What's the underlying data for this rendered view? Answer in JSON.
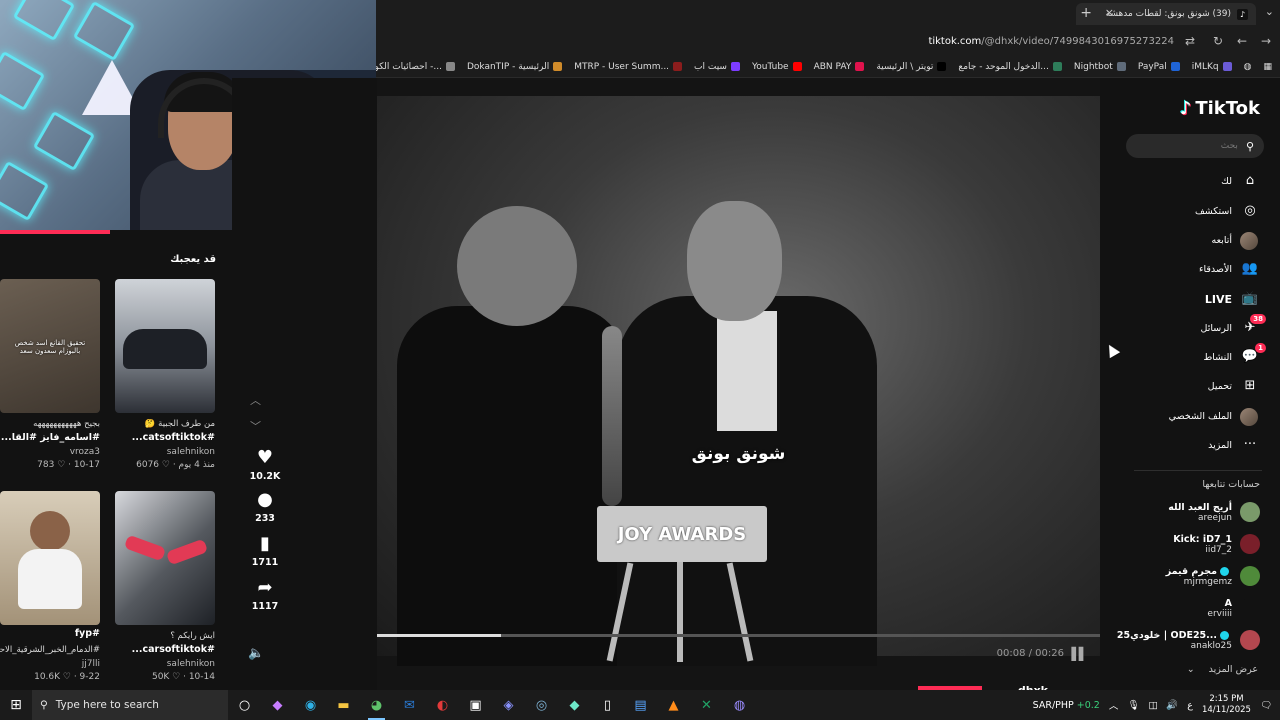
{
  "browser": {
    "tab_title": "(39) شونق بونق: لقطات مدهشة",
    "tab_close": "×",
    "new_tab": "+",
    "tab_menu": "⌄",
    "url_domain": "tiktok.com",
    "url_path": "/@dhxk/video/7499843016975273224",
    "bookmarks": [
      {
        "label": "iMLKq",
        "color": "#6b5bd6"
      },
      {
        "label": "PayPal",
        "color": "#1f64d6"
      },
      {
        "label": "Nightbot",
        "color": "#5f6b7a"
      },
      {
        "label": "الدخول الموحد - جامع...",
        "color": "#2e7d5a"
      },
      {
        "label": "تويتر \\ الرئيسية",
        "color": "#000000"
      },
      {
        "label": "ABN PAY",
        "color": "#e0134d"
      },
      {
        "label": "YouTube",
        "color": "#ff0000"
      },
      {
        "label": "سيت اب",
        "color": "#7d3cff"
      },
      {
        "label": "MTRP - User Summ...",
        "color": "#8b1d1d"
      },
      {
        "label": "DokanTIP - الرئيسية",
        "color": "#d08b2a"
      },
      {
        "label": "احصائيات الكوبون -...",
        "color": "#888888"
      },
      {
        "label": "احصائيات",
        "color": "#e0134d"
      }
    ]
  },
  "left": {
    "section_title": "قد يعجبك",
    "recs": [
      {
        "cap1": "بجيح هههههههههههه",
        "cap2": "#اسامه_فايز #القا...",
        "author": "vroza3",
        "meta": "783 ♡ · 10-17",
        "thumb_color": "#5a5148",
        "overlay": "تحقيق القانع اسد شخص بالبوزام سعدون سعد"
      },
      {
        "cap1": "من طرف الجبية 🤔",
        "cap2": "#catsoftiktok...",
        "author": "salehnikon",
        "meta": "6076 ♡ · منذ 4 يوم",
        "thumb_color": "#9aa0a8",
        "overlay": ""
      },
      {
        "cap1": "",
        "cap2": "#fyp",
        "author": "",
        "meta": "",
        "thumb_color": "#c4b49c",
        "overlay": ""
      },
      {
        "cap1": "ايش رايكم ؟",
        "cap2": "#carsoftiktok...",
        "author": "salehnikon",
        "meta": "50K ♡ · 10-14",
        "thumb_color": "#3b3f47",
        "overlay": ""
      }
    ],
    "rec3_cap1": "#الدمام_الخبر_الشرقية_الاحـ...",
    "rec3_author": "jj7lli",
    "rec3_meta": "10.6K ♡ · 9-22"
  },
  "actions": {
    "likes": "10.2K",
    "comments": "233",
    "saves": "1711",
    "shares": "1117"
  },
  "video": {
    "subtitle": "شونق بونق",
    "podium_text": "JOY AWARDS",
    "time": "00:08 / 00:26",
    "progress": 0.31,
    "author": "dhxk"
  },
  "sidebar": {
    "logo": "TikTok",
    "search_placeholder": "بحث",
    "nav": [
      {
        "label": "لك",
        "icon": "⌂"
      },
      {
        "label": "استكشف",
        "icon": "◎"
      },
      {
        "label": "أتابعه",
        "icon": "avatar"
      },
      {
        "label": "الأصدقاء",
        "icon": "👥"
      },
      {
        "label": "LIVE",
        "icon": "📺"
      },
      {
        "label": "الرسائل",
        "icon": "✈",
        "badge": "38"
      },
      {
        "label": "النشاط",
        "icon": "💬",
        "badge": "1"
      },
      {
        "label": "تحميل",
        "icon": "⊞"
      },
      {
        "label": "الملف الشخصي",
        "icon": "avatar"
      },
      {
        "label": "المزيد",
        "icon": "···"
      }
    ],
    "following_title": "حسابات تتابعها",
    "following": [
      {
        "name": "أريج العبد الله",
        "user": "areejun",
        "color": "#7a9a6a",
        "verified": false
      },
      {
        "name": "Kick: iD7_1",
        "user": "iid7_2",
        "color": "#7a1f2a",
        "verified": false
      },
      {
        "name": "مجرم قيمز",
        "user": "mjrmgemz",
        "color": "#4f8a3a",
        "verified": true
      },
      {
        "name": "A",
        "user": "erviiii",
        "color": "#121212",
        "verified": false
      },
      {
        "name": "خلودي25 | ODE25...",
        "user": "anaklo25",
        "color": "#b4474f",
        "verified": true
      }
    ],
    "show_more": "عرض المزيد"
  },
  "taskbar": {
    "search_placeholder": "Type here to search",
    "currency": "SAR/PHP",
    "currency_change": "+0.2",
    "lang": "ع",
    "time": "2:15 PM",
    "date": "14/11/2025"
  }
}
